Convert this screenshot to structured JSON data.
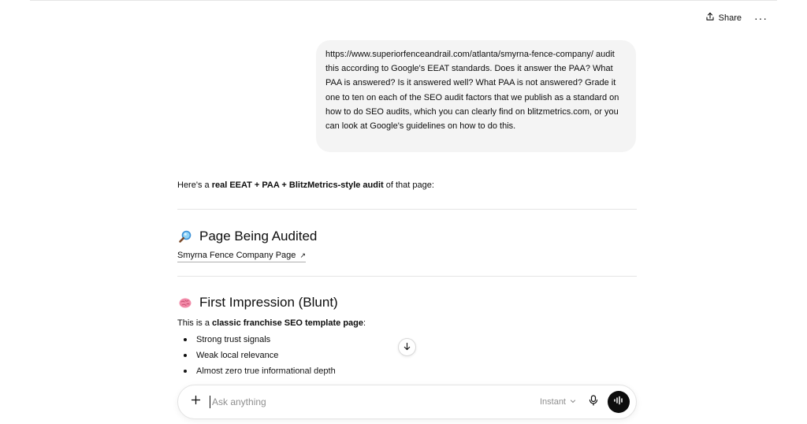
{
  "header": {
    "share_label": "Share",
    "more_label": "···"
  },
  "user_message": {
    "text": "https://www.superiorfenceandrail.com/atlanta/smyrna-fence-company/ audit this according to Google's EEAT standards. Does it answer the PAA? What PAA is answered? Is it answered well? What PAA is not answered? Grade it one to ten on each of the SEO audit factors that we publish as a standard on how to do SEO audits, which you can clearly find on blitzmetrics.com, or you can look at Google's guidelines on how to do this."
  },
  "assistant": {
    "intro_prefix": "Here's a ",
    "intro_bold": "real EEAT + PAA + BlitzMetrics-style audit",
    "intro_suffix": " of that page:",
    "section1_emoji": "🔎",
    "section1_title": "Page Being Audited",
    "section1_link": "Smyrna Fence Company Page",
    "section1_link_arrow": "↗",
    "section2_emoji": "🧠",
    "section2_title": "First Impression (Blunt)",
    "section2_para_prefix": "This is a ",
    "section2_para_bold": "classic franchise SEO template page",
    "section2_para_suffix": ":",
    "bullets": [
      "Strong trust signals",
      "Weak local relevance",
      "Almost zero true informational depth"
    ]
  },
  "composer": {
    "placeholder": "Ask anything",
    "model_label": "Instant"
  },
  "icons": {
    "share": "share-icon",
    "scroll": "arrow-down-icon",
    "plus": "plus-icon",
    "mic": "microphone-icon",
    "voice": "voice-mode-icon"
  }
}
